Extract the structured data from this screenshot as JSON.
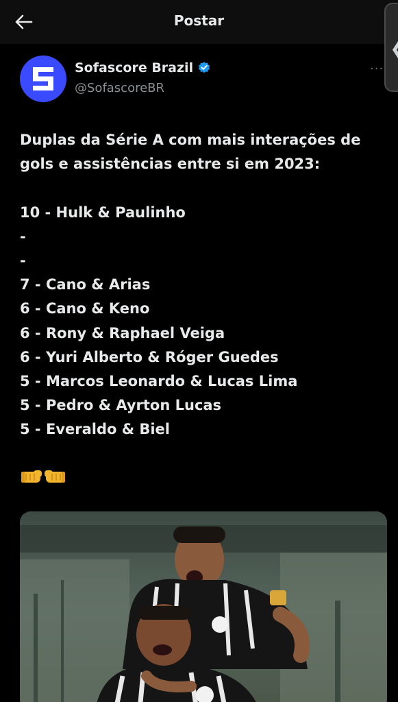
{
  "header": {
    "title": "Postar"
  },
  "author": {
    "name": "Sofascore Brazil",
    "handle": "@SofascoreBR",
    "verified": true,
    "avatar_color": "#3a4bff",
    "verified_color": "#1d9bf0"
  },
  "post": {
    "intro_line1": "Duplas da Série A com mais interações de",
    "intro_line2": "gols e assistências entre si em 2023:",
    "lines": [
      "10 - Hulk & Paulinho",
      "-",
      "-",
      "7 - Cano & Arias",
      "6 - Cano & Keno",
      "6 - Rony & Raphael Veiga",
      "6 - Yuri Alberto & Róger Guedes",
      "5 - Marcos Leonardo & Lucas Lima",
      "5 - Pedro & Ayrton Lucas",
      "5 - Everaldo & Biel"
    ],
    "emoji": "🤜🤛"
  },
  "icons": {
    "back": "back-arrow-icon",
    "more": "more-options-icon",
    "verified": "verified-badge-icon",
    "side": "chevron-left-icon"
  }
}
